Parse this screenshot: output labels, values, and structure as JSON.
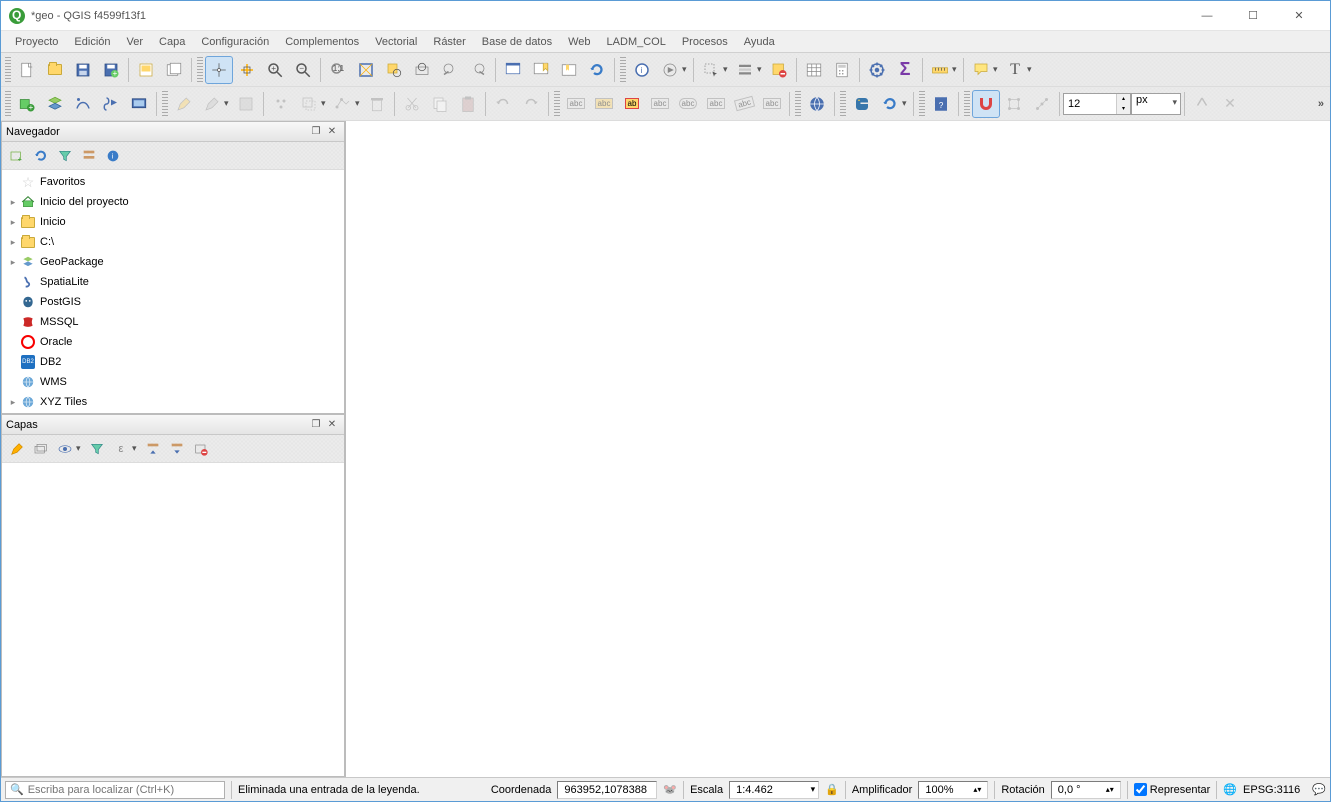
{
  "window": {
    "title": "*geo - QGIS f4599f13f1"
  },
  "menu": [
    "Proyecto",
    "Edición",
    "Ver",
    "Capa",
    "Configuración",
    "Complementos",
    "Vectorial",
    "Ráster",
    "Base de datos",
    "Web",
    "LADM_COL",
    "Procesos",
    "Ayuda"
  ],
  "toolbar2": {
    "size_value": "12",
    "size_unit": "px"
  },
  "panels": {
    "browser": {
      "title": "Navegador"
    },
    "layers": {
      "title": "Capas"
    }
  },
  "browser_tree": [
    {
      "label": "Favoritos",
      "icon": "star",
      "expandable": false
    },
    {
      "label": "Inicio del proyecto",
      "icon": "proj-home",
      "expandable": true
    },
    {
      "label": "Inicio",
      "icon": "folder",
      "expandable": true
    },
    {
      "label": "C:\\",
      "icon": "folder",
      "expandable": true
    },
    {
      "label": "GeoPackage",
      "icon": "geopackage",
      "expandable": true
    },
    {
      "label": "SpatiaLite",
      "icon": "spatialite",
      "expandable": false
    },
    {
      "label": "PostGIS",
      "icon": "postgis",
      "expandable": false
    },
    {
      "label": "MSSQL",
      "icon": "mssql",
      "expandable": false
    },
    {
      "label": "Oracle",
      "icon": "oracle",
      "expandable": false
    },
    {
      "label": "DB2",
      "icon": "db2",
      "expandable": false
    },
    {
      "label": "WMS",
      "icon": "globe",
      "expandable": false
    },
    {
      "label": "XYZ Tiles",
      "icon": "globe",
      "expandable": true
    }
  ],
  "status": {
    "locator_placeholder": "Escriba para localizar (Ctrl+K)",
    "message": "Eliminada una entrada de la leyenda.",
    "coord_label": "Coordenada",
    "coord_value": "963952,1078388",
    "scale_label": "Escala",
    "scale_value": "1:4.462",
    "magnifier_label": "Amplificador",
    "magnifier_value": "100%",
    "rotation_label": "Rotación",
    "rotation_value": "0,0 °",
    "render_label": "Representar",
    "crs": "EPSG:3116"
  }
}
